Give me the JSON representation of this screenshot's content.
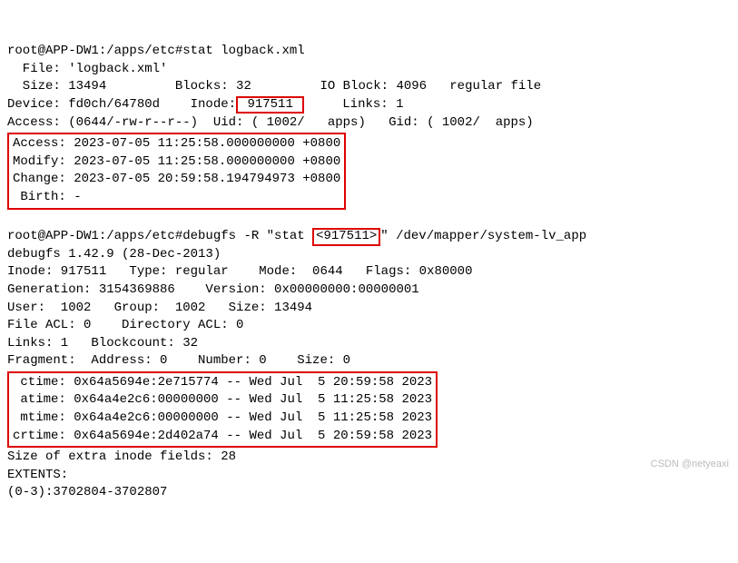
{
  "stat": {
    "cmd": "root@APP-DW1:/apps/etc#stat logback.xml",
    "file_line": "  File: 'logback.xml'",
    "size_line_pre": "  Size: 13494         Blocks: 32         IO Block: 4096   regular file",
    "device_pre": "Device: fd0ch/64780d    Inode:",
    "inode_boxed": " 917511 ",
    "device_post": "     Links: 1",
    "access_perm": "Access: (0644/-rw-r--r--)  Uid: ( 1002/   apps)   Gid: ( 1002/  apps)",
    "block": "Access: 2023-07-05 11:25:58.000000000 +0800\nModify: 2023-07-05 11:25:58.000000000 +0800\nChange: 2023-07-05 20:59:58.194794973 +0800\n Birth: -"
  },
  "debugfs": {
    "cmd_pre": "root@APP-DW1:/apps/etc#debugfs -R \"stat ",
    "inode_boxed": "<917511>",
    "cmd_post": "\" /dev/mapper/system-lv_app",
    "line_version": "debugfs 1.42.9 (28-Dec-2013)",
    "line_inode": "Inode: 917511   Type: regular    Mode:  0644   Flags: 0x80000",
    "line_gen": "Generation: 3154369886    Version: 0x00000000:00000001",
    "line_user": "User:  1002   Group:  1002   Size: 13494",
    "line_acl": "File ACL: 0    Directory ACL: 0",
    "line_links": "Links: 1   Blockcount: 32",
    "line_frag": "Fragment:  Address: 0    Number: 0    Size: 0",
    "block": " ctime: 0x64a5694e:2e715774 -- Wed Jul  5 20:59:58 2023\n atime: 0x64a4e2c6:00000000 -- Wed Jul  5 11:25:58 2023\n mtime: 0x64a4e2c6:00000000 -- Wed Jul  5 11:25:58 2023\ncrtime: 0x64a5694e:2d402a74 -- Wed Jul  5 20:59:58 2023",
    "line_extra": "Size of extra inode fields: 28",
    "line_extents": "EXTENTS:",
    "line_range": "(0-3):3702804-3702807"
  },
  "watermark": "CSDN @netyeaxi",
  "chart_data": {
    "type": "table",
    "title": "stat / debugfs output for logback.xml inode 917511",
    "stat": {
      "file": "logback.xml",
      "size": 13494,
      "blocks": 32,
      "io_block": 4096,
      "type": "regular file",
      "device": "fd0ch/64780d",
      "inode": 917511,
      "links": 1,
      "mode": "0644",
      "perm": "-rw-r--r--",
      "uid": 1002,
      "uname": "apps",
      "gid": 1002,
      "gname": "apps",
      "access": "2023-07-05 11:25:58.000000000 +0800",
      "modify": "2023-07-05 11:25:58.000000000 +0800",
      "change": "2023-07-05 20:59:58.194794973 +0800",
      "birth": "-"
    },
    "debugfs": {
      "version": "1.42.9 (28-Dec-2013)",
      "inode": 917511,
      "type": "regular",
      "mode": "0644",
      "flags": "0x80000",
      "generation": 3154369886,
      "version_field": "0x00000000:00000001",
      "user": 1002,
      "group": 1002,
      "size": 13494,
      "file_acl": 0,
      "directory_acl": 0,
      "links": 1,
      "blockcount": 32,
      "fragment": {
        "address": 0,
        "number": 0,
        "size": 0
      },
      "ctime": {
        "hex": "0x64a5694e:2e715774",
        "text": "Wed Jul  5 20:59:58 2023"
      },
      "atime": {
        "hex": "0x64a4e2c6:00000000",
        "text": "Wed Jul  5 11:25:58 2023"
      },
      "mtime": {
        "hex": "0x64a4e2c6:00000000",
        "text": "Wed Jul  5 11:25:58 2023"
      },
      "crtime": {
        "hex": "0x64a5694e:2d402a74",
        "text": "Wed Jul  5 20:59:58 2023"
      },
      "extra_inode_fields": 28,
      "extents": "(0-3):3702804-3702807"
    }
  }
}
